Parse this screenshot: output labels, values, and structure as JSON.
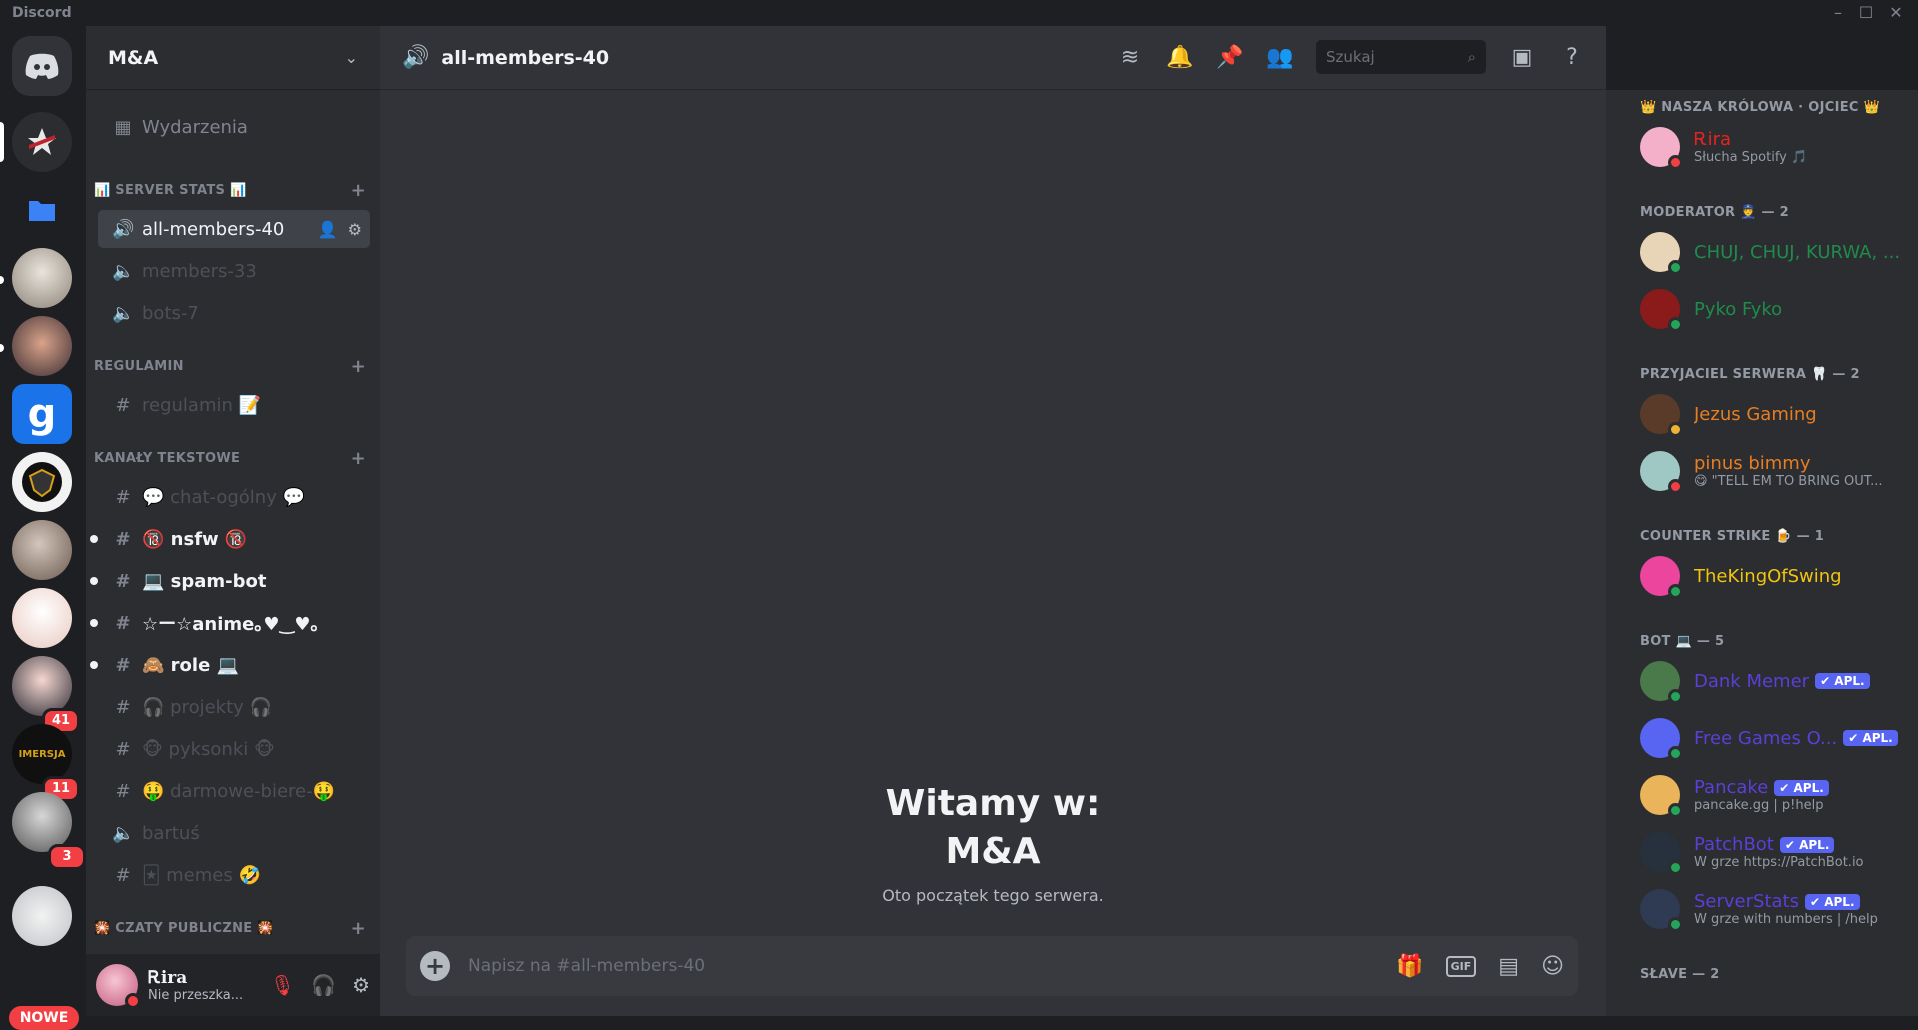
{
  "window": {
    "title": "Discord"
  },
  "guilds": {
    "nowe_label": "NOWE",
    "badges": [
      "41",
      "11",
      "3"
    ]
  },
  "server": {
    "name": "M&A"
  },
  "channels": {
    "events": "Wydarzenia",
    "cat_stats": "📊 SERVER STATS 📊",
    "stats": [
      "all-members-40",
      "members-33",
      "bots-7"
    ],
    "cat_rules": "REGULAMIN",
    "rules": "regulamin 📝",
    "cat_text": "KANAŁY TEKSTOWE",
    "text": [
      "💬 chat-ogólny 💬",
      "🔞 nsfw 🔞",
      "💻 spam-bot",
      "☆ー☆anime｡♥‿♥｡",
      "🙈 role 💻",
      "🎧 projekty 🎧",
      "🐵 pyksonki 🐵",
      "🤑 darmowe-biere-🤑",
      "bartuś",
      "🃏 memes 🤣"
    ],
    "cat_voice": "🎇 CZATY PUBLICZNE 🎇"
  },
  "user": {
    "name": "Ꭱira",
    "status": "Nie przeszka..."
  },
  "header": {
    "channel": "all-members-40",
    "search_placeholder": "Szukaj"
  },
  "welcome": {
    "line1": "Witamy w:",
    "line2": "M&A",
    "sub": "Oto początek tego serwera."
  },
  "composer": {
    "placeholder": "Napisz na #all-members-40",
    "gif": "GIF"
  },
  "member_list": {
    "groups": [
      {
        "title": "👑 NASZA KRÓLOWA · OJCIEC 👑",
        "members": [
          {
            "name": "Ꭱira",
            "sub": "Słucha Spotify 🎵",
            "color": "#e8231f",
            "status": "#f23f43"
          }
        ]
      },
      {
        "title": "MODERATOR 👮 — 2",
        "members": [
          {
            "name": "CHUJ, CHUJ, KURWA, ...",
            "sub": "",
            "color": "#1f8b4c",
            "status": "#23a55a"
          },
          {
            "name": "Pyko Fyko",
            "sub": "",
            "color": "#1f8b4c",
            "status": "#23a55a"
          }
        ]
      },
      {
        "title": "PRZYJACIEL SERWERA 🦷 — 2",
        "members": [
          {
            "name": "Jezus Gaming",
            "sub": "",
            "color": "#e67e22",
            "status": "#f0b232"
          },
          {
            "name": "pinus bimmy",
            "sub": "😋 \"TELL EM TO BRING OUT...",
            "color": "#e67e22",
            "status": "#f23f43"
          }
        ]
      },
      {
        "title": "COUNTER STRIKE 🍺 — 1",
        "members": [
          {
            "name": "TheKingOfSwing",
            "sub": "",
            "color": "#f1c40f",
            "status": "#23a55a"
          }
        ]
      },
      {
        "title": "BOT 💻 — 5",
        "members": [
          {
            "name": "Dank Memer",
            "sub": "",
            "color": "#5b3fd6",
            "status": "#23a55a",
            "tag": "✔ APL."
          },
          {
            "name": "Free Games O...",
            "sub": "",
            "color": "#5b3fd6",
            "status": "#23a55a",
            "tag": "✔ APL."
          },
          {
            "name": "Pancake",
            "sub": "pancake.gg | p!help",
            "color": "#5b3fd6",
            "status": "#23a55a",
            "tag": "✔ APL."
          },
          {
            "name": "PatchBot",
            "sub": "W grze https://PatchBot.io",
            "color": "#5b3fd6",
            "status": "#23a55a",
            "tag": "✔ APL."
          },
          {
            "name": "ServerStats",
            "sub": "W grze with numbers | /help",
            "color": "#5b3fd6",
            "status": "#23a55a",
            "tag": "✔ APL."
          }
        ]
      },
      {
        "title": "SŁAVE — 2",
        "members": []
      }
    ]
  }
}
